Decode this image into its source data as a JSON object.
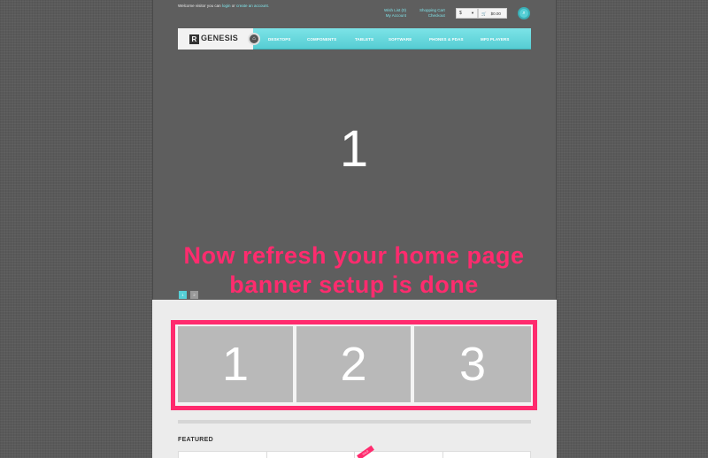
{
  "header": {
    "welcome_prefix": "Welcome visitor you can",
    "login_link": "login",
    "or_text": "or",
    "create_account_link": "create an account.",
    "wish_list": "Wish List (0)",
    "my_account": "My Account",
    "shopping_cart": "Shopping Cart",
    "checkout": "Checkout",
    "currency": "$",
    "cart_total": "$0.00"
  },
  "nav": {
    "logo_mark": "R",
    "logo_text": "GENESIS",
    "items": [
      "DESKTOPS",
      "COMPONENTS",
      "TABLETS",
      "SOFTWARE",
      "PHONES & PDAS",
      "MP3 PLAYERS"
    ]
  },
  "slider": {
    "slide_number": "1",
    "pager": [
      "1",
      "2"
    ]
  },
  "annotation": {
    "line1": "Now refresh your home page",
    "line2": "banner setup is done"
  },
  "banners": [
    "1",
    "2",
    "3"
  ],
  "featured": {
    "heading": "FEATURED",
    "sale_badge": "SALE"
  },
  "colors": {
    "accent": "#56cfd6",
    "highlight": "#ff2b6e",
    "background": "#5a5a5a"
  }
}
